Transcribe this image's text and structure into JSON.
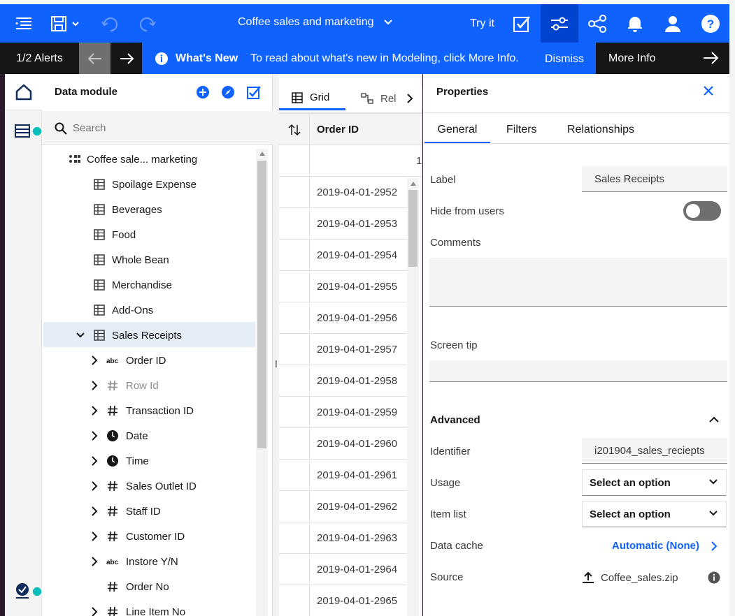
{
  "topbar": {
    "title": "Coffee sales and marketing",
    "try_it": "Try it"
  },
  "alerts": {
    "count": "1/2 Alerts",
    "whats_new": "What's New",
    "message": "To read about what's new in Modeling, click More Info.",
    "dismiss": "Dismiss",
    "more_info": "More Info"
  },
  "data_module": {
    "title": "Data module",
    "search_placeholder": "Search",
    "root": "Coffee sale... marketing",
    "tables": [
      "Spoilage Expense",
      "Beverages",
      "Food",
      "Whole Bean",
      "Merchandise",
      "Add-Ons"
    ],
    "selected_table": "Sales Receipts",
    "columns": [
      {
        "name": "Order ID",
        "type": "abc",
        "expandable": true,
        "dim": false
      },
      {
        "name": "Row Id",
        "type": "#",
        "expandable": true,
        "dim": true
      },
      {
        "name": "Transaction ID",
        "type": "#",
        "expandable": true,
        "dim": false
      },
      {
        "name": "Date",
        "type": "clock",
        "expandable": true,
        "dim": false
      },
      {
        "name": "Time",
        "type": "clock",
        "expandable": true,
        "dim": false
      },
      {
        "name": "Sales Outlet ID",
        "type": "#",
        "expandable": true,
        "dim": false
      },
      {
        "name": "Staff ID",
        "type": "#",
        "expandable": true,
        "dim": false
      },
      {
        "name": "Customer ID",
        "type": "#",
        "expandable": true,
        "dim": false
      },
      {
        "name": "Instore Y/N",
        "type": "abc",
        "expandable": true,
        "dim": false
      },
      {
        "name": "Order No",
        "type": "#",
        "expandable": false,
        "dim": false
      },
      {
        "name": "Line Item No",
        "type": "#",
        "expandable": true,
        "dim": false
      }
    ]
  },
  "grid": {
    "tab_grid": "Grid",
    "tab_relationships": "Rel",
    "column_header": "Order ID",
    "first_row": "1",
    "rows": [
      "2019-04-01-2952",
      "2019-04-01-2953",
      "2019-04-01-2954",
      "2019-04-01-2955",
      "2019-04-01-2956",
      "2019-04-01-2957",
      "2019-04-01-2958",
      "2019-04-01-2959",
      "2019-04-01-2960",
      "2019-04-01-2961",
      "2019-04-01-2962",
      "2019-04-01-2963",
      "2019-04-01-2964",
      "2019-04-01-2965"
    ]
  },
  "properties": {
    "title": "Properties",
    "tabs": {
      "general": "General",
      "filters": "Filters",
      "relationships": "Relationships"
    },
    "label_label": "Label",
    "label_value": "Sales Receipts",
    "hide_label": "Hide from users",
    "comments_label": "Comments",
    "screentip_label": "Screen tip",
    "advanced_title": "Advanced",
    "identifier_label": "Identifier",
    "identifier_value": "i201904_sales_reciepts",
    "usage_label": "Usage",
    "usage_value": "Select an option",
    "itemlist_label": "Item list",
    "itemlist_value": "Select an option",
    "datacache_label": "Data cache",
    "datacache_value": "Automatic (None)",
    "source_label": "Source",
    "source_value": "Coffee_sales.zip"
  },
  "colors": {
    "primary": "#0f62fe",
    "dark": "#161616",
    "teal": "#08bdba"
  }
}
